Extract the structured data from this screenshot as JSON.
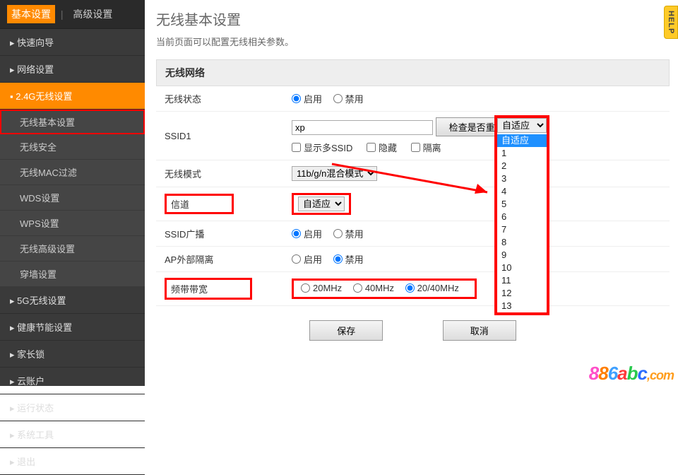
{
  "tabs": {
    "basic": "基本设置",
    "advanced": "高级设置"
  },
  "sidebar": {
    "items": [
      "快速向导",
      "网络设置",
      "2.4G无线设置",
      "5G无线设置",
      "健康节能设置",
      "家长锁",
      "云账户",
      "运行状态",
      "系统工具",
      "退出"
    ],
    "sub24": [
      "无线基本设置",
      "无线安全",
      "无线MAC过滤",
      "WDS设置",
      "WPS设置",
      "无线高级设置",
      "穿墙设置"
    ]
  },
  "page": {
    "title": "无线基本设置",
    "desc": "当前页面可以配置无线相关参数。"
  },
  "section": {
    "header": "无线网络"
  },
  "form": {
    "status": {
      "label": "无线状态",
      "enable": "启用",
      "disable": "禁用"
    },
    "ssid1": {
      "label": "SSID1",
      "value": "xp",
      "check_btn": "检查是否重复",
      "multi": "显示多SSID",
      "hide": "隐藏",
      "isolate": "隔离"
    },
    "mode": {
      "label": "无线模式",
      "value": "11b/g/n混合模式"
    },
    "channel": {
      "label": "信道",
      "value": "自适应"
    },
    "broadcast": {
      "label": "SSID广播",
      "enable": "启用",
      "disable": "禁用"
    },
    "ap_isolate": {
      "label": "AP外部隔离",
      "enable": "启用",
      "disable": "禁用"
    },
    "bandwidth": {
      "label": "频带带宽",
      "v1": "20MHz",
      "v2": "40MHz",
      "v3": "20/40MHz"
    }
  },
  "actions": {
    "save": "保存",
    "cancel": "取消"
  },
  "popup": {
    "selected": "自适应",
    "options": [
      "自适应",
      "1",
      "2",
      "3",
      "4",
      "5",
      "6",
      "7",
      "8",
      "9",
      "10",
      "11",
      "12",
      "13"
    ]
  },
  "help": "HELP",
  "watermark": "886abc,com"
}
